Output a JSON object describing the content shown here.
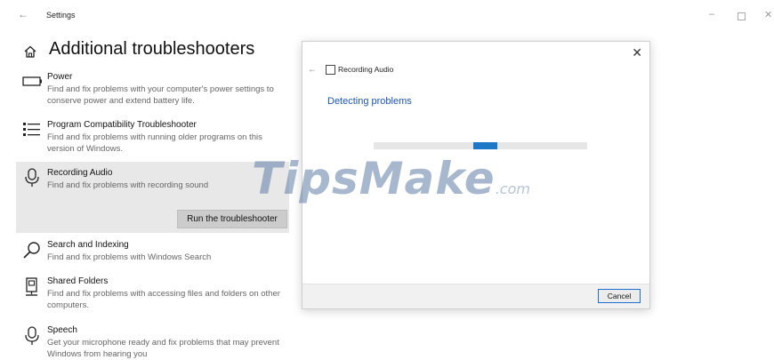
{
  "window": {
    "title": "Settings"
  },
  "page": {
    "title": "Additional troubleshooters"
  },
  "troubleshooters": [
    {
      "name": "Power",
      "description": "Find and fix problems with your computer's power settings to conserve power and extend battery life.",
      "icon": "power-icon"
    },
    {
      "name": "Program Compatibility Troubleshooter",
      "description": "Find and fix problems with running older programs on this version of Windows.",
      "icon": "program-list-icon"
    },
    {
      "name": "Recording Audio",
      "description": "Find and fix problems with recording sound",
      "icon": "microphone-icon",
      "selected": true,
      "action_label": "Run the troubleshooter"
    },
    {
      "name": "Search and Indexing",
      "description": "Find and fix problems with Windows Search",
      "icon": "search-icon"
    },
    {
      "name": "Shared Folders",
      "description": "Find and fix problems with accessing files and folders on other computers.",
      "icon": "shared-folders-icon"
    },
    {
      "name": "Speech",
      "description": "Get your microphone ready and fix problems that may prevent Windows from hearing you",
      "icon": "speech-mic-icon"
    }
  ],
  "dialog": {
    "title": "Recording Audio",
    "status": "Detecting problems",
    "cancel_label": "Cancel",
    "progress_position": 0.5
  },
  "watermark": {
    "main": "TipsMake",
    "suffix": ".com"
  },
  "colors": {
    "accent": "#1a55b8",
    "progress": "#1e78c8",
    "selected_bg": "#e8e8e8"
  }
}
